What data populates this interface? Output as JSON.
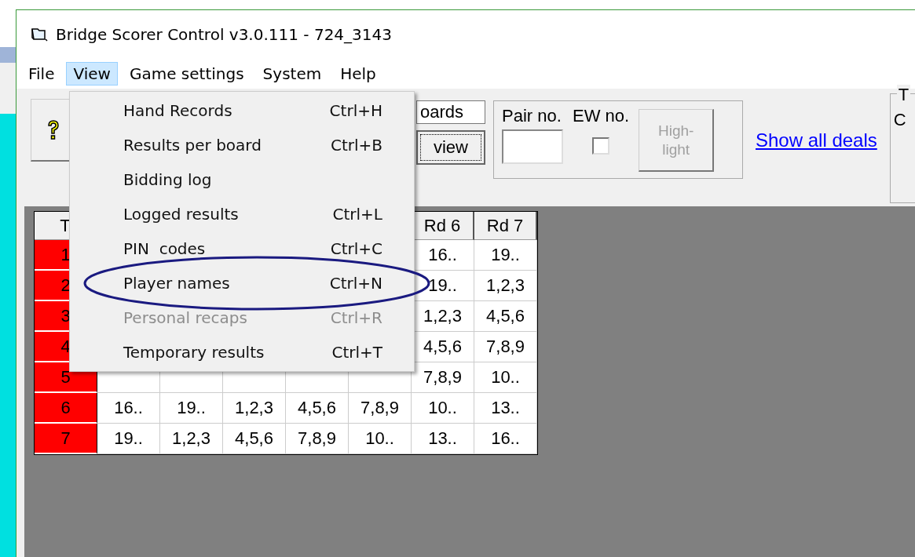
{
  "window": {
    "title": "Bridge Scorer Control v3.0.111  - 724_3143"
  },
  "menubar": [
    {
      "label": "File",
      "selected": false
    },
    {
      "label": "View",
      "selected": true
    },
    {
      "label": "Game settings",
      "selected": false
    },
    {
      "label": "System",
      "selected": false
    },
    {
      "label": "Help",
      "selected": false
    }
  ],
  "view_menu": [
    {
      "label": "Hand Records",
      "shortcut": "Ctrl+H",
      "disabled": false,
      "circled": false
    },
    {
      "label": "Results per board",
      "shortcut": "Ctrl+B",
      "disabled": false,
      "circled": false
    },
    {
      "label": "Bidding log",
      "disabled": false,
      "circled": false
    },
    {
      "label": "Logged results",
      "shortcut": "Ctrl+L",
      "disabled": false,
      "circled": false
    },
    {
      "label": "PIN  codes",
      "shortcut": "Ctrl+C",
      "disabled": false,
      "circled": false
    },
    {
      "label": "Player names",
      "shortcut": "Ctrl+N",
      "disabled": false,
      "circled": true
    },
    {
      "label": "Personal recaps",
      "shortcut": "Ctrl+R",
      "disabled": true,
      "circled": false
    },
    {
      "label": "Temporary results",
      "shortcut": "Ctrl+T",
      "disabled": false,
      "circled": false
    }
  ],
  "toolbar": {
    "boards_button": "oards",
    "view_button": "view",
    "pair_group": {
      "pair_label": "Pair no.",
      "ew_label": "EW no.",
      "ew_checked": false,
      "highlight_button": {
        "lines": [
          "High-",
          "light"
        ],
        "disabled": true
      }
    },
    "show_all_deals": "Show all deals",
    "right_group": {
      "title": "T",
      "text": "C"
    }
  },
  "table": {
    "columns": [
      "T",
      "",
      "",
      "",
      "",
      "",
      "Rd 6",
      "Rd 7"
    ],
    "rows": [
      {
        "cells": [
          "1",
          "",
          "",
          "",
          "",
          "",
          "16..",
          "19.."
        ]
      },
      {
        "cells": [
          "2",
          "",
          "",
          "",
          "",
          "",
          "19..",
          "1,2,3"
        ]
      },
      {
        "cells": [
          "3",
          "",
          "",
          "",
          "",
          "",
          "1,2,3",
          "4,5,6"
        ]
      },
      {
        "cells": [
          "4",
          "",
          "",
          "",
          "",
          "",
          "4,5,6",
          "7,8,9"
        ]
      },
      {
        "cells": [
          "5",
          "",
          "",
          "",
          "",
          "",
          "7,8,9",
          "10.."
        ]
      },
      {
        "cells": [
          "6",
          "16..",
          "19..",
          "1,2,3",
          "4,5,6",
          "7,8,9",
          "10..",
          "13.."
        ]
      },
      {
        "cells": [
          "7",
          "19..",
          "1,2,3",
          "4,5,6",
          "7,8,9",
          "10..",
          "13..",
          "16.."
        ]
      }
    ]
  }
}
